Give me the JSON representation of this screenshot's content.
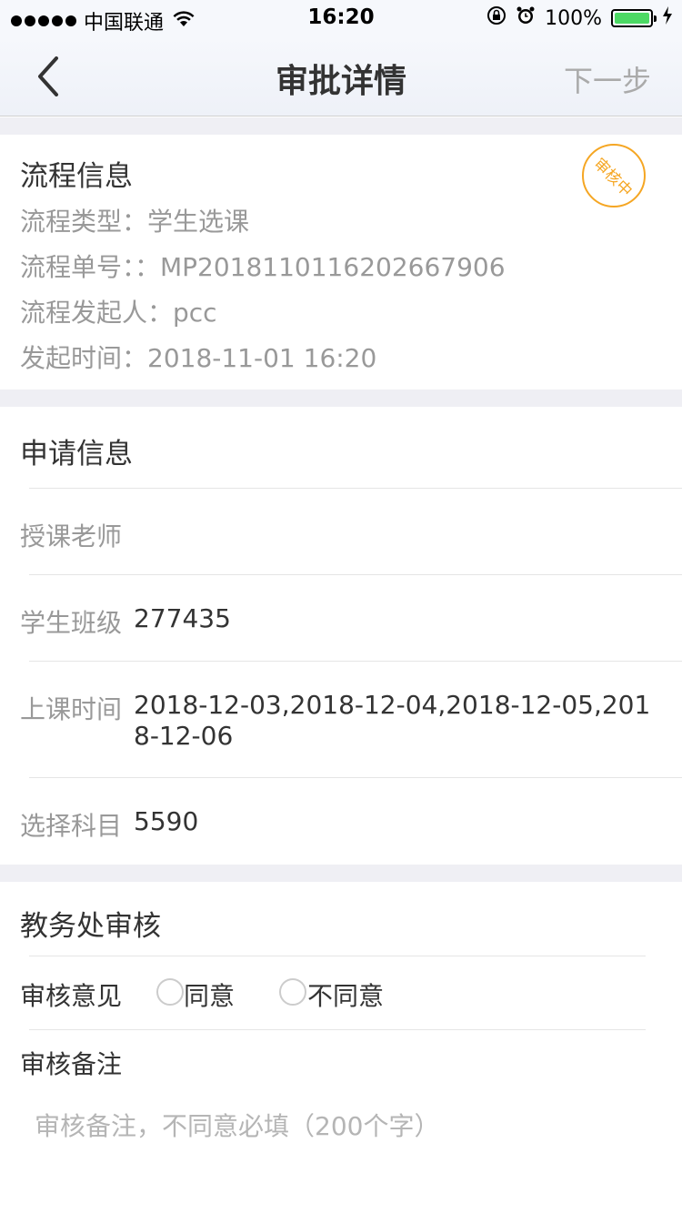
{
  "status_bar": {
    "carrier": "中国联通",
    "time": "16:20",
    "battery": "100%",
    "battery_level": 1.0,
    "icons": [
      "signal-dots-icon",
      "wifi-icon",
      "orientation-lock-icon",
      "alarm-icon",
      "battery-icon",
      "charging-bolt-icon"
    ]
  },
  "nav": {
    "back_icon": "chevron-left-icon",
    "title": "审批详情",
    "next": "下一步"
  },
  "process": {
    "title": "流程信息",
    "type": "流程类型：学生选课",
    "number": "流程单号：：MP2018110116202667906",
    "initiator": "流程发起人：pcc",
    "start_time": "发起时间：2018-11-01 16:20",
    "stamp": "审核中",
    "stamp_color": "#f5a623"
  },
  "application": {
    "title": "申请信息",
    "rows": [
      {
        "label": "授课老师",
        "value": ""
      },
      {
        "label": "学生班级",
        "value": "277435"
      },
      {
        "label": "上课时间",
        "value": "2018-12-03,2018-12-04,2018-12-05,2018-12-06"
      },
      {
        "label": "选择科目",
        "value": "5590"
      }
    ]
  },
  "review": {
    "title": "教务处审核",
    "opinion_label": "审核意见",
    "options": [
      "同意",
      "不同意"
    ],
    "remark_label": "审核备注",
    "remark_placeholder": "审核备注，不同意必填（200个字）"
  }
}
